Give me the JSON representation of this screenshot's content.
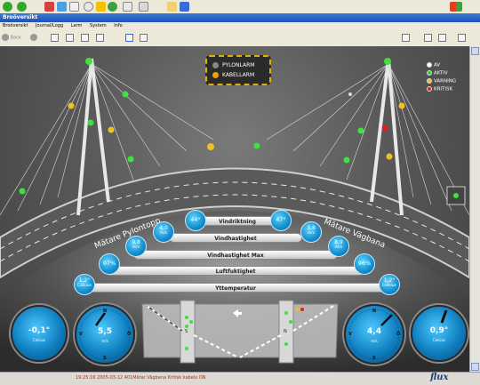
{
  "window_title": "Broöversikt",
  "menu": [
    "Broöversikt",
    "Journal/Logg",
    "Larm",
    "System",
    "Info"
  ],
  "toolbar": {
    "back_label": "Back",
    "forward_label": ""
  },
  "alarm_panel": {
    "pylon": "PYLONLARM",
    "cable": "KABELLARM"
  },
  "legend": [
    {
      "label": "AV",
      "color": "#ffffff"
    },
    {
      "label": "AKTIV",
      "color": "#2fd22f"
    },
    {
      "label": "VARNING",
      "color": "#f0c020"
    },
    {
      "label": "KRITISK",
      "color": "#e02020"
    }
  ],
  "labels": {
    "left_curve": "Mätare Pylontopp",
    "right_curve": "Mätare Vägbana"
  },
  "rows": [
    {
      "label": "Vindriktning",
      "left": {
        "value": "44°",
        "unit": ""
      },
      "right": {
        "value": "47°",
        "unit": ""
      }
    },
    {
      "label": "Vindhastighet",
      "left": {
        "value": "4,0",
        "unit": "m/s"
      },
      "right": {
        "value": "3,8",
        "unit": "m/s"
      }
    },
    {
      "label": "Vindhastighet Max",
      "left": {
        "value": "9,8",
        "unit": "m/s"
      },
      "right": {
        "value": "8,9",
        "unit": "m/s"
      }
    },
    {
      "label": "Luftfuktighet",
      "left": {
        "value": "97%",
        "unit": ""
      },
      "right": {
        "value": "96%",
        "unit": ""
      }
    },
    {
      "label": "Yttemperatur",
      "left": {
        "value": "1,2°",
        "unit": "Celsius"
      },
      "right": {
        "value": "1,2°",
        "unit": "Celsius"
      }
    }
  ],
  "dials": {
    "temp_left": {
      "value": "-0,1°",
      "unit": "Celsius"
    },
    "wind_left": {
      "value": "5,5",
      "unit": "m/s"
    },
    "wind_right": {
      "value": "4,4",
      "unit": "m/s"
    },
    "temp_right": {
      "value": "0,9°",
      "unit": "Celsius"
    },
    "compass": [
      "N",
      "Ö",
      "S",
      "V"
    ]
  },
  "status_bar": {
    "text": "19:25:16    2005-03-12    401Mätar Vägbana    Kritisk kabelx                    ON",
    "logo": "flux"
  }
}
